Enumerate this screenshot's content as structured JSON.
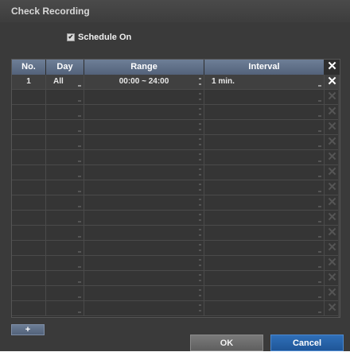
{
  "dialog": {
    "title": "Check Recording",
    "schedule_label": "Schedule On",
    "schedule_checked": true
  },
  "table": {
    "headers": {
      "no": "No.",
      "day": "Day",
      "range": "Range",
      "interval": "Interval",
      "delete_icon": "close-icon"
    },
    "rows": [
      {
        "no": "1",
        "day": "All",
        "range": "00:00 ~ 24:00",
        "interval": "1 min."
      }
    ]
  },
  "buttons": {
    "add": "+",
    "ok": "OK",
    "cancel": "Cancel"
  },
  "colors": {
    "header_bg": "#5d6c84",
    "cancel_bg": "#2764a8",
    "panel_bg": "#3a3a3a"
  }
}
